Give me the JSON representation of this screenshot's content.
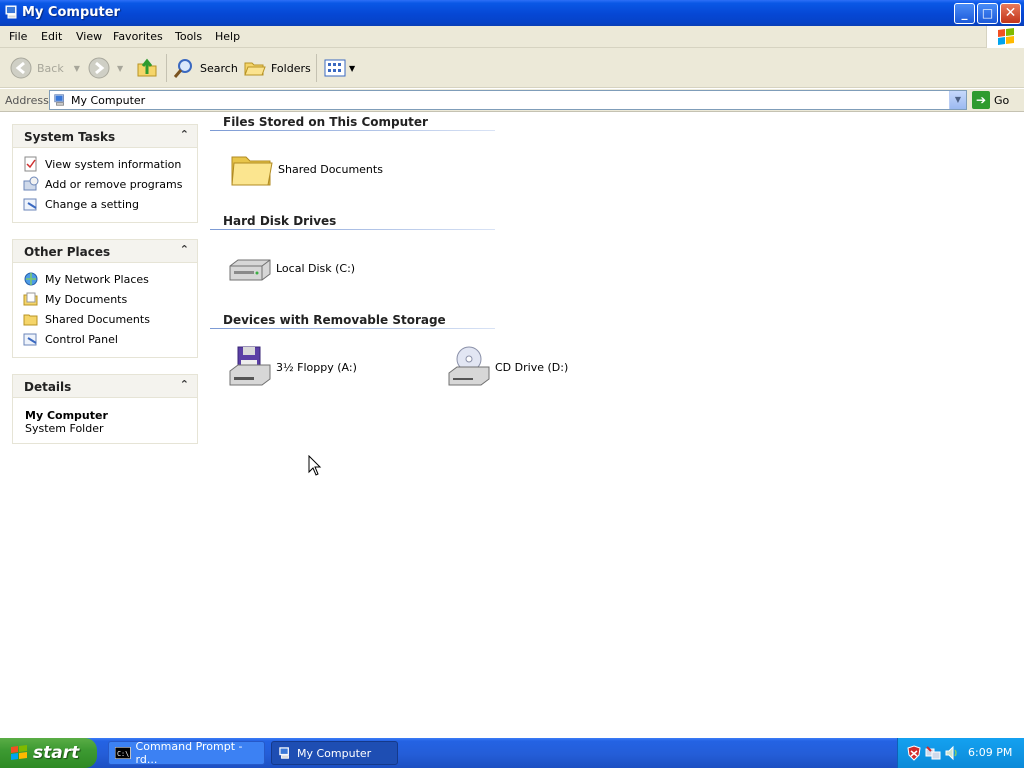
{
  "window": {
    "title": "My Computer",
    "controls": {
      "minimize": "_",
      "maximize": "□",
      "close": "✕"
    }
  },
  "menubar": {
    "items": [
      "File",
      "Edit",
      "View",
      "Favorites",
      "Tools",
      "Help"
    ]
  },
  "toolbar": {
    "back_label": "Back",
    "search_label": "Search",
    "folders_label": "Folders"
  },
  "address": {
    "label": "Address",
    "value": "My Computer",
    "go_label": "Go"
  },
  "tasks": {
    "system_tasks": {
      "title": "System Tasks",
      "items": [
        "View system information",
        "Add or remove programs",
        "Change a setting"
      ]
    },
    "other_places": {
      "title": "Other Places",
      "items": [
        "My Network Places",
        "My Documents",
        "Shared Documents",
        "Control Panel"
      ]
    },
    "details": {
      "title": "Details",
      "name": "My Computer",
      "type": "System Folder"
    }
  },
  "content": {
    "groups": [
      {
        "title": "Files Stored on This Computer",
        "items": [
          "Shared Documents"
        ]
      },
      {
        "title": "Hard Disk Drives",
        "items": [
          "Local Disk (C:)"
        ]
      },
      {
        "title": "Devices with Removable Storage",
        "items": [
          "3½ Floppy (A:)",
          "CD Drive (D:)"
        ]
      }
    ]
  },
  "taskbar": {
    "start_label": "start",
    "buttons": [
      "Command Prompt - rd...",
      "My Computer"
    ],
    "clock": "6:09 PM"
  },
  "colors": {
    "title_bar": "#0647d4",
    "taskbar": "#245dd7",
    "start_button": "#3d9a32",
    "tray": "#0c8ad8"
  }
}
